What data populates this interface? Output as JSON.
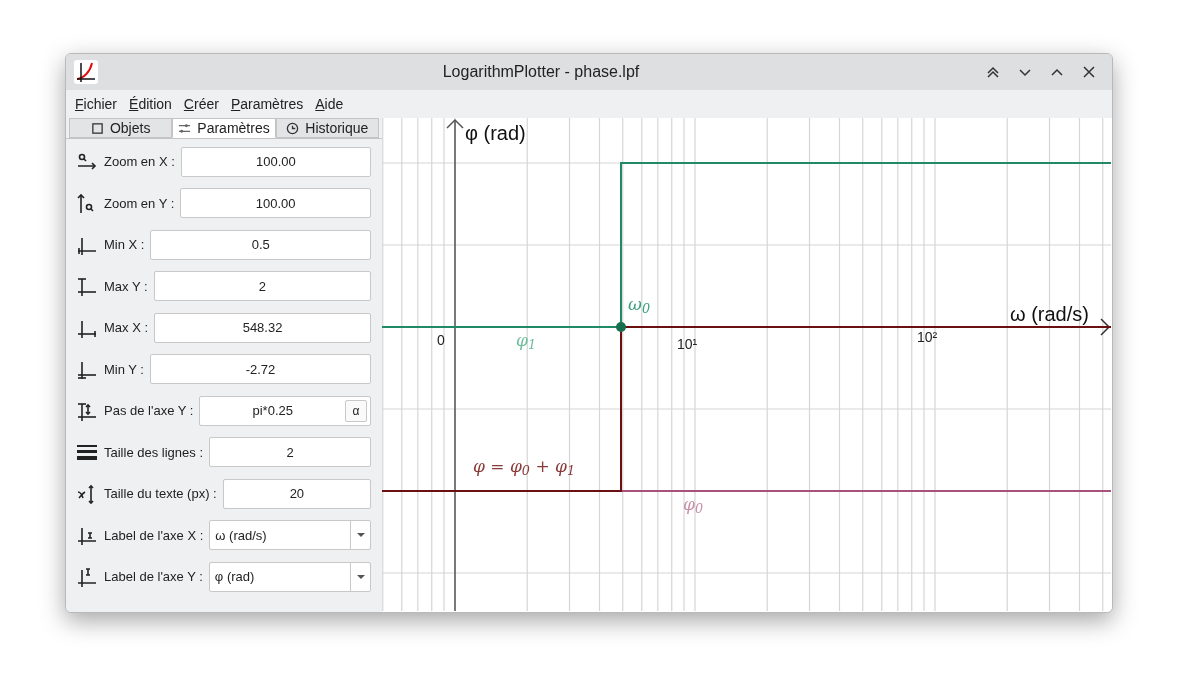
{
  "window": {
    "title": "LogarithmPlotter - phase.lpf"
  },
  "menu": [
    "Fichier",
    "Édition",
    "Créer",
    "Paramètres",
    "Aide"
  ],
  "tabs": [
    {
      "label": "Objets",
      "selected": false
    },
    {
      "label": "Paramètres",
      "selected": true
    },
    {
      "label": "Historique",
      "selected": false
    }
  ],
  "settings": [
    {
      "kind": "input",
      "label": "Zoom en X :",
      "value": "100.00"
    },
    {
      "kind": "input",
      "label": "Zoom en Y :",
      "value": "100.00"
    },
    {
      "kind": "input",
      "label": "Min X :",
      "value": "0.5"
    },
    {
      "kind": "input",
      "label": "Max Y :",
      "value": "2"
    },
    {
      "kind": "input",
      "label": "Max X :",
      "value": "548.32"
    },
    {
      "kind": "input",
      "label": "Min Y :",
      "value": "-2.72"
    },
    {
      "kind": "input-symbol",
      "label": "Pas de l'axe Y :",
      "value": "pi*0.25",
      "button": "α"
    },
    {
      "kind": "input",
      "label": "Taille des lignes :",
      "value": "2"
    },
    {
      "kind": "input",
      "label": "Taille du texte (px) :",
      "value": "20"
    },
    {
      "kind": "select",
      "label": "Label de l'axe X :",
      "value": "ω (rad/s)"
    },
    {
      "kind": "select",
      "label": "Label de l'axe Y :",
      "value": "φ (rad)"
    }
  ],
  "plot": {
    "y_axis_label": "φ (rad)",
    "x_axis_label": "ω (rad/s)",
    "x_ticks": [
      "0",
      "10¹",
      "10²"
    ],
    "labels": [
      {
        "text": "ω$_{0}$",
        "color": "#3aa07a"
      },
      {
        "text": "φ$_{1}$",
        "color": "#6cbf9c"
      },
      {
        "text": "φ = φ$_{0}$ + φ$_{1}$",
        "color": "#8b3a3a"
      },
      {
        "text": "φ$_{0}$",
        "color": "#c88fa9"
      }
    ]
  }
}
